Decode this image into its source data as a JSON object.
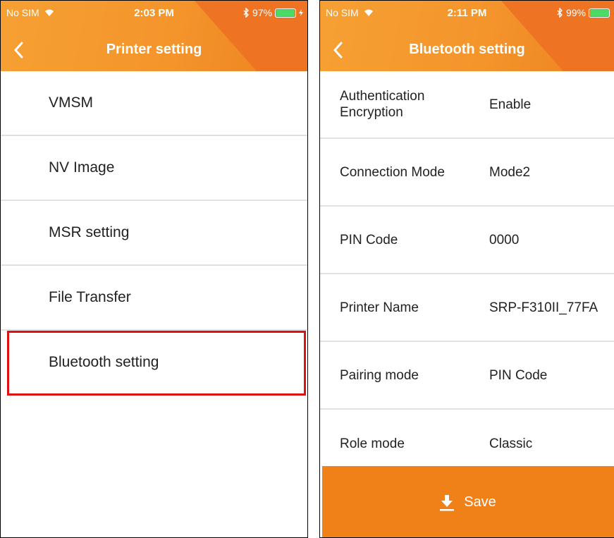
{
  "left_screen": {
    "status_bar": {
      "carrier": "No SIM",
      "time": "2:03 PM",
      "battery": "97%",
      "battery_level": 0.97
    },
    "title": "Printer setting",
    "menu_items": [
      {
        "label": "VMSM"
      },
      {
        "label": "NV Image"
      },
      {
        "label": "MSR setting"
      },
      {
        "label": "File Transfer"
      },
      {
        "label": "Bluetooth setting",
        "selected": true
      }
    ]
  },
  "right_screen": {
    "status_bar": {
      "carrier": "No SIM",
      "time": "2:11 PM",
      "battery": "99%",
      "battery_level": 0.99
    },
    "title": "Bluetooth setting",
    "settings": [
      {
        "label": "Authentication Encryption",
        "value": "Enable"
      },
      {
        "label": "Connection Mode",
        "value": "Mode2"
      },
      {
        "label": "PIN Code",
        "value": "0000"
      },
      {
        "label": "Printer Name",
        "value": "SRP-F310II_77FA"
      },
      {
        "label": "Pairing mode",
        "value": "PIN Code"
      },
      {
        "label": "Role mode",
        "value": "Classic"
      }
    ],
    "save_label": "Save"
  },
  "colors": {
    "header_orange": "#f4952c",
    "save_orange": "#f08018",
    "selection_red": "#e01010",
    "battery_green": "#4cd964"
  }
}
